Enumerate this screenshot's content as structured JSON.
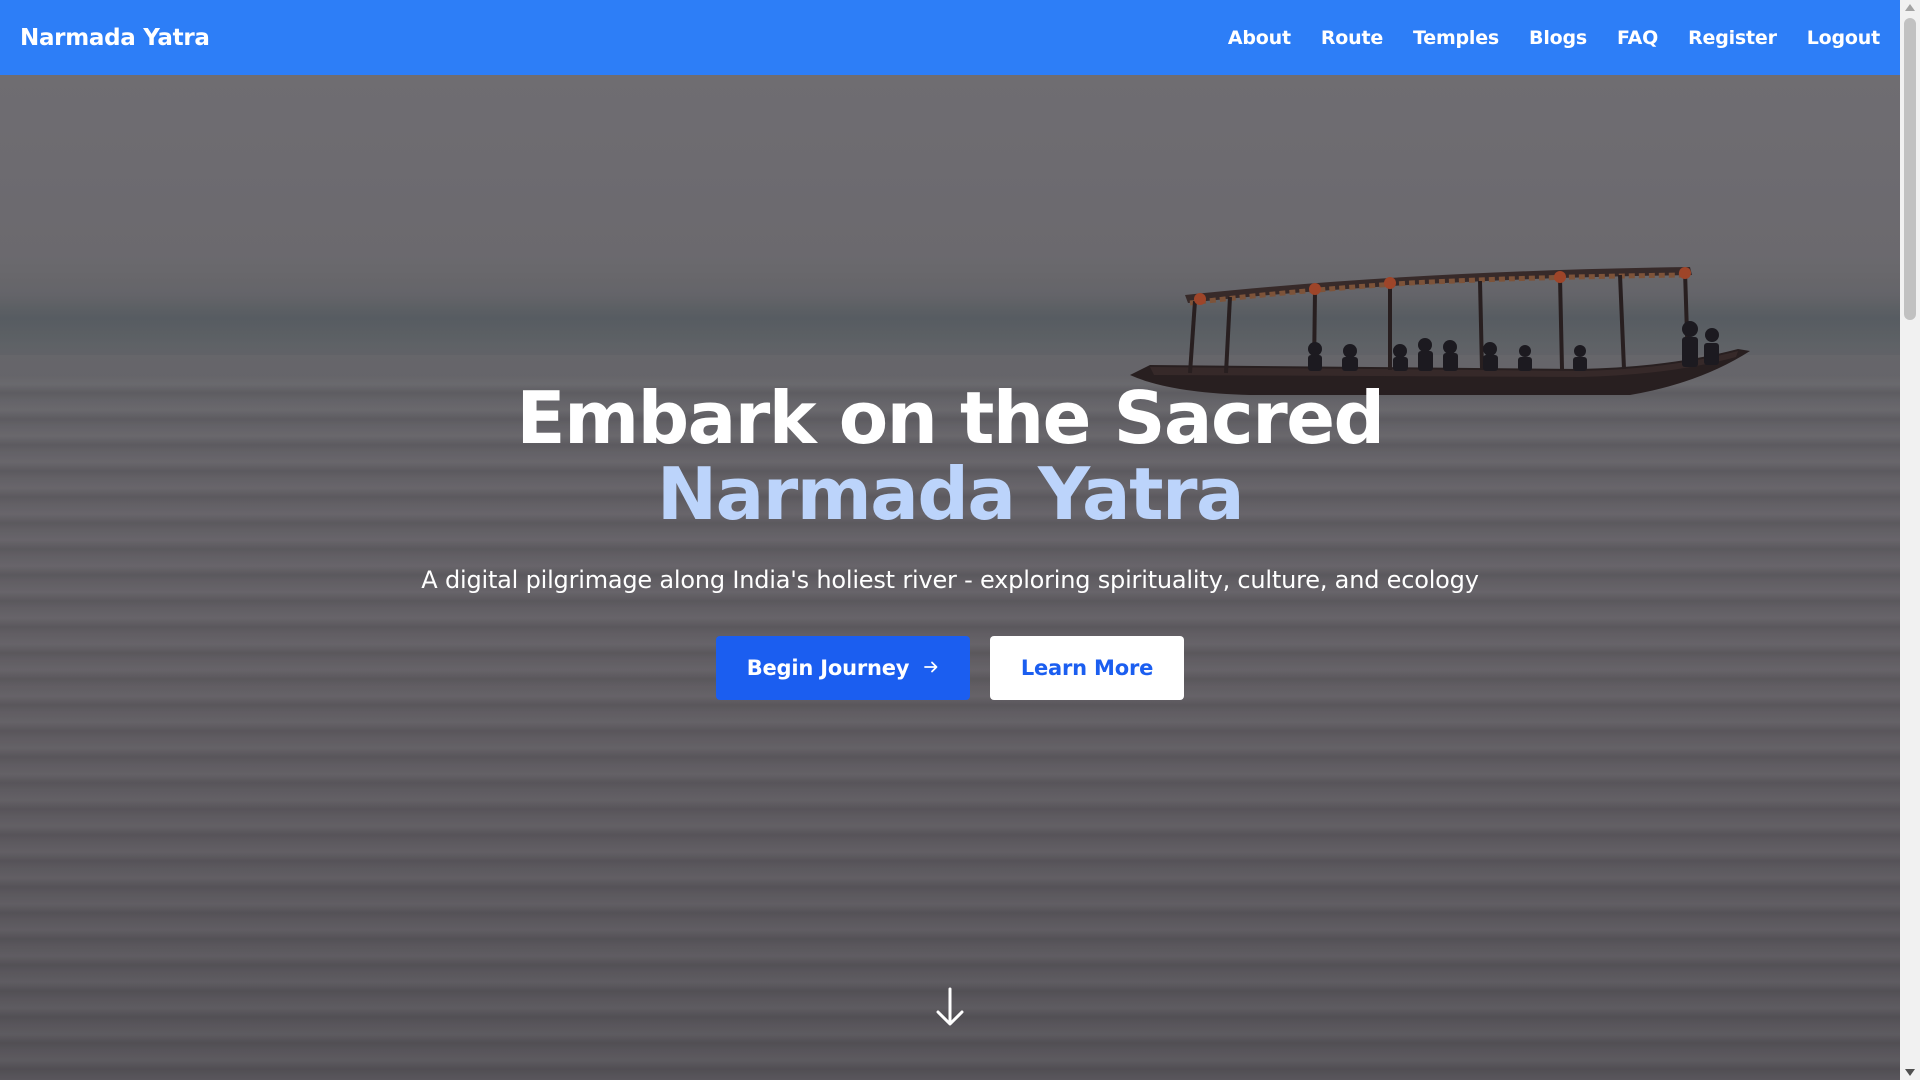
{
  "navbar": {
    "brand": "Narmada Yatra",
    "links": [
      "About",
      "Route",
      "Temples",
      "Blogs",
      "FAQ",
      "Register",
      "Logout"
    ]
  },
  "hero": {
    "headline_line1": "Embark on the Sacred",
    "headline_line2": "Narmada Yatra",
    "subtitle": "A digital pilgrimage along India's holiest river - exploring spirituality, culture, and ecology",
    "primary_button": "Begin Journey",
    "secondary_button": "Learn More",
    "primary_icon": "arrow-right-icon",
    "scroll_icon": "arrow-down-icon"
  },
  "colors": {
    "navbar_bg": "#2d7ef7",
    "accent_text": "#bcd4fb",
    "primary_button": "#1b5ef0",
    "secondary_button_bg": "#ffffff"
  }
}
